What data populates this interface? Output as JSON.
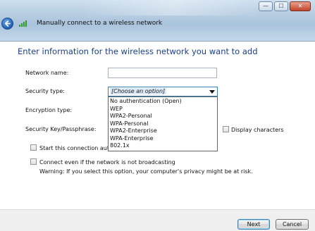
{
  "window": {
    "title": "Manually connect to a wireless network",
    "controls": {
      "minimize": "—",
      "maximize": "☐",
      "close": "✕"
    }
  },
  "page": {
    "heading": "Enter information for the wireless network you want to add"
  },
  "form": {
    "network_name_label": "Network name:",
    "network_name_value": "",
    "security_type_label": "Security type:",
    "security_type_value": "[Choose an option]",
    "security_type_options": [
      "No authentication (Open)",
      "WEP",
      "WPA2-Personal",
      "WPA-Personal",
      "WPA2-Enterprise",
      "WPA-Enterprise",
      "802.1x"
    ],
    "encryption_type_label": "Encryption type:",
    "security_key_label": "Security Key/Passphrase:",
    "display_characters_label": "Display characters",
    "start_auto_label": "Start this connection auto",
    "connect_not_broadcasting_label": "Connect even if the network is not broadcasting",
    "warning_text": "Warning: If you select this option, your computer's privacy might be at risk."
  },
  "footer": {
    "next_label": "Next",
    "cancel_label": "Cancel"
  },
  "icons": {
    "back": "back-arrow-icon",
    "wireless": "wireless-signal-icon"
  },
  "colors": {
    "heading": "#1b3f87",
    "focus_border": "#3c7fb1"
  }
}
